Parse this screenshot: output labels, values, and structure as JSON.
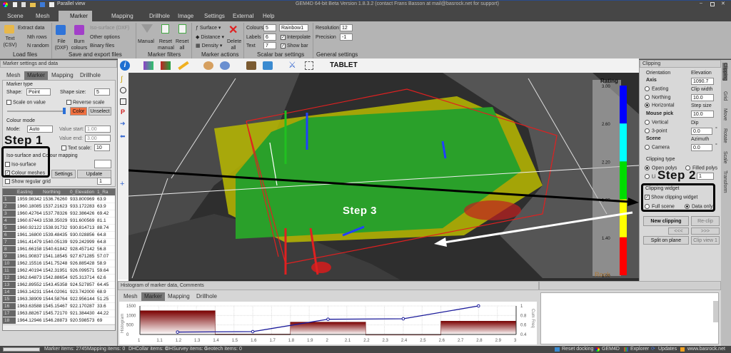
{
  "titlebar": {
    "parallel_view": "Parallel view",
    "title": "GEM4D 64-bit Beta Version 1.8.3.2 (contact Frans Basson at mail@basrock.net for support)"
  },
  "menu": [
    "Scene",
    "Mesh",
    "Marker",
    "Mapping",
    "Drillhole",
    "Image",
    "Settings",
    "External",
    "Help"
  ],
  "ribbon": {
    "load": {
      "extract": "Extract data",
      "nth": "Nth rows",
      "random": "N random",
      "text_csv": "Text (CSV)",
      "label": "Load files"
    },
    "save": {
      "file_dxf": "File (DXF)",
      "burn": "Burn colours",
      "iso": "Iso-surface (DXF)",
      "other": "Other options",
      "binary": "Binary files",
      "label": "Save and export files"
    },
    "filters": {
      "manual": "Manual",
      "reset_manual": "Reset manual",
      "reset_all": "Reset all",
      "label": "Marker filters"
    },
    "actions": {
      "surface": "Surface",
      "distance": "Distance",
      "density": "Density",
      "delete_all": "Delete all",
      "label": "Marker actions"
    },
    "scalar": {
      "colours_label": "Colours",
      "colours": "5",
      "labels_label": "Labels",
      "labels": "6",
      "text_label": "Text",
      "text": "7",
      "palette": "Rainbow1",
      "interpolate": "Interpolate",
      "show_bar": "Show bar",
      "label": "Scalar bar settings"
    },
    "general": {
      "resolution_label": "Resolution",
      "resolution": "12",
      "precision_label": "Precision",
      "precision": "-1",
      "label": "General settings"
    }
  },
  "left": {
    "title": "Marker settings and data",
    "tabs": [
      "Mesh",
      "Marker",
      "Mapping",
      "Drillhole"
    ],
    "marker_type": "Marker type",
    "shape_label": "Shape:",
    "shape": "Point",
    "size_label": "Shape size:",
    "size": "5",
    "scale_on_value": "Scale on value",
    "reverse_scale": "Reverse scale",
    "color_btn": "Color",
    "unselect_btn": "Unselect",
    "colour_mode": "Colour mode",
    "mode_label": "Mode:",
    "mode": "Auto",
    "value_start_label": "Value start:",
    "value_start": "1.00",
    "value_end_label": "Value end:",
    "value_end": "3.00",
    "text_scale_label": "Text scale:",
    "text_scale": "10",
    "iso_group": "Iso-surface and Colour mapping",
    "iso_surface": "Iso-surface",
    "colour_meshes": "Colour meshes",
    "settings_btn": "Settings",
    "update_btn": "Update",
    "show_grid": "Show regular grid",
    "grid_val": "1",
    "columns": [
      "Easting",
      "Northing",
      "0_Elevation",
      "1_Ra"
    ],
    "rows": [
      [
        "1",
        "1959.98342",
        "1536.76260",
        "933.800969",
        "63.9"
      ],
      [
        "2",
        "1960.18085",
        "1537.21623",
        "933.172283",
        "63.9"
      ],
      [
        "3",
        "1960.42764",
        "1537.78326",
        "932.386426",
        "69.42"
      ],
      [
        "4",
        "1960.67443",
        "1538.35029",
        "931.600569",
        "81.1"
      ],
      [
        "5",
        "1960.92122",
        "1538.91732",
        "930.814713",
        "88.74"
      ],
      [
        "6",
        "1961.16800",
        "1539.48435",
        "930.028856",
        "64.8"
      ],
      [
        "7",
        "1961.41479",
        "1540.05139",
        "929.242999",
        "64.8"
      ],
      [
        "8",
        "1961.66158",
        "1540.61842",
        "928.457142",
        "56.8"
      ],
      [
        "9",
        "1961.90837",
        "1541.18545",
        "927.671285",
        "57.07"
      ],
      [
        "10",
        "1962.15516",
        "1541.75248",
        "926.885428",
        "58.9"
      ],
      [
        "11",
        "1962.40194",
        "1542.31951",
        "926.099571",
        "59.64"
      ],
      [
        "12",
        "1962.64873",
        "1542.88654",
        "925.313714",
        "62.6"
      ],
      [
        "13",
        "1962.89552",
        "1543.45358",
        "924.527857",
        "64.45"
      ],
      [
        "14",
        "1963.14231",
        "1544.02061",
        "923.742000",
        "68.9"
      ],
      [
        "15",
        "1963.38909",
        "1544.58764",
        "922.956144",
        "51.25"
      ],
      [
        "16",
        "1963.63588",
        "1545.15467",
        "922.170287",
        "33.6"
      ],
      [
        "17",
        "1963.88267",
        "1545.72170",
        "921.384430",
        "44.22"
      ],
      [
        "18",
        "1964.12946",
        "1546.28873",
        "920.598573",
        "69"
      ]
    ]
  },
  "toolbar": {
    "tablet": "TABLET"
  },
  "annotations": {
    "step1": "Step 1",
    "step2": "Step 2",
    "step3": "Step 3"
  },
  "colorbar": {
    "title": "Rating",
    "labels": [
      "3.00",
      "2.60",
      "2.20",
      "1.80",
      "1.40",
      "1.00"
    ],
    "colors": [
      "#0000ff",
      "#00ffff",
      "#00dd00",
      "#ffff00",
      "#ff0000"
    ],
    "watermark": "Rock"
  },
  "clipping": {
    "title": "Clipping",
    "orientation": "Orientation",
    "axis": "Axis",
    "easting": "Easting",
    "northing": "Northing",
    "horizontal": "Horizontal",
    "mouse_pick": "Mouse pick",
    "vertical": "Vertical",
    "three_point": "3-point",
    "scene": "Scene",
    "camera": "Camera",
    "elevation_label": "Elevation",
    "elevation": "1090.7",
    "clip_width_label": "Clip width",
    "clip_width": "10.0",
    "step_size_label": "Step size",
    "step_size": "10.0",
    "dip_label": "Dip",
    "dip": "0.0",
    "azimuth_label": "Azimuth",
    "azimuth": "0.0",
    "deg": "°",
    "clipping_type": "Clipping type",
    "open_polys": "Open polys",
    "filled_polys": "Filled polys",
    "lines": "Li",
    "lines_val": "1",
    "widget": "Clipping widget",
    "show_widget": "Show clipping widget",
    "full_scene": "Full scene",
    "data_only": "Data only",
    "new_clipping": "New clipping",
    "reclip": "Re-clip",
    "prev": "<<<",
    "next": ">>>",
    "split": "Split on plane",
    "clip_view": "Clip view 1"
  },
  "vtabs": [
    "Clipping",
    "Grid",
    "Move",
    "Rotate",
    "Scale",
    "Transform"
  ],
  "histogram": {
    "title": "Histogram of marker data, Comments",
    "tabs": [
      "Mesh",
      "Marker",
      "Mapping",
      "Drillhole"
    ]
  },
  "chart_data": {
    "type": "bar",
    "title": "Histogram of marker data",
    "ylabel": "Histogram",
    "y2label": "Cum Freq",
    "xlim": [
      1,
      3
    ],
    "ylim": [
      0,
      1500
    ],
    "y2lim": [
      0.4,
      1
    ],
    "xticks": [
      "1",
      "1.1",
      "1.2",
      "1.3",
      "1.4",
      "1.5",
      "1.6",
      "1.7",
      "1.8",
      "1.9",
      "2",
      "2.1",
      "2.2",
      "2.3",
      "2.4",
      "2.5",
      "2.6",
      "2.7",
      "2.8",
      "2.9",
      "3"
    ],
    "yticks": [
      "0",
      "500",
      "1000",
      "1500"
    ],
    "y2ticks": [
      "0.4",
      "0.6",
      "0.8",
      "1"
    ],
    "bins": [
      [
        1,
        1.4
      ],
      [
        1.4,
        1.8
      ],
      [
        1.8,
        2.2
      ],
      [
        2.2,
        2.6
      ],
      [
        2.6,
        3
      ]
    ],
    "values": [
      1250,
      20,
      650,
      5,
      700
    ],
    "cum_freq": {
      "x": [
        1.2,
        1.6,
        2.0,
        2.4,
        2.8
      ],
      "y": [
        0.45,
        0.46,
        0.72,
        0.73,
        1.0
      ]
    }
  },
  "status": {
    "marker": "Marker items: 2745",
    "mapping": "Mapping items: 0",
    "dhcollar": "DHCollar items: 0",
    "dhsurvey": "DHSurvey items: 0",
    "geotech": "Geotech items: 0",
    "reset_docking": "Reset docking",
    "gem4d": "GEM4D",
    "explorer": "Explorer",
    "updates": "Updates",
    "website": "www.basrock.net"
  }
}
